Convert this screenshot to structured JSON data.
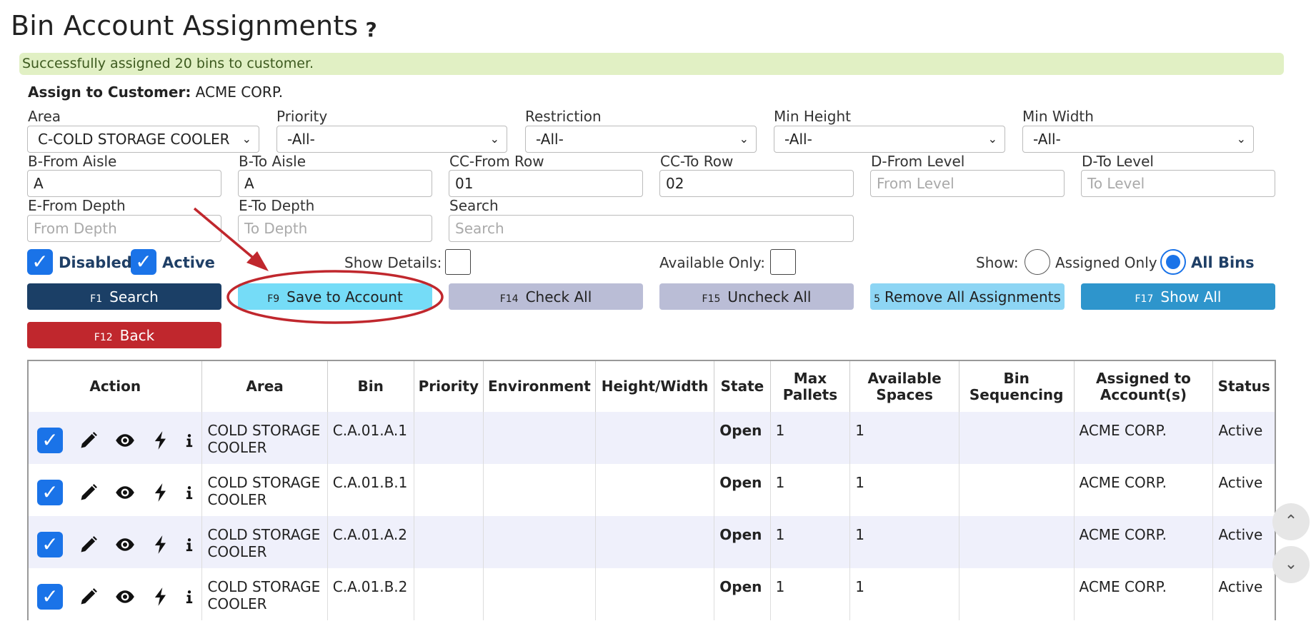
{
  "page": {
    "title": "Bin Account Assignments",
    "help_glyph": "?"
  },
  "alert": "Successfully assigned 20 bins to customer.",
  "assign": {
    "label": "Assign to Customer:",
    "value": "ACME CORP."
  },
  "filters": {
    "area": {
      "label": "Area",
      "value": "C-COLD STORAGE COOLER"
    },
    "priority": {
      "label": "Priority",
      "value": "-All-"
    },
    "restriction": {
      "label": "Restriction",
      "value": "-All-"
    },
    "min_height": {
      "label": "Min Height",
      "value": "-All-"
    },
    "min_width": {
      "label": "Min Width",
      "value": "-All-"
    },
    "from_aisle": {
      "label": "B-From Aisle",
      "value": "A",
      "placeholder": ""
    },
    "to_aisle": {
      "label": "B-To Aisle",
      "value": "A",
      "placeholder": ""
    },
    "from_row": {
      "label": "CC-From Row",
      "value": "01",
      "placeholder": ""
    },
    "to_row": {
      "label": "CC-To Row",
      "value": "02",
      "placeholder": ""
    },
    "from_level": {
      "label": "D-From Level",
      "value": "",
      "placeholder": "From Level"
    },
    "to_level": {
      "label": "D-To Level",
      "value": "",
      "placeholder": "To Level"
    },
    "from_depth": {
      "label": "E-From Depth",
      "value": "",
      "placeholder": "From Depth"
    },
    "to_depth": {
      "label": "E-To Depth",
      "value": "",
      "placeholder": "To Depth"
    },
    "search": {
      "label": "Search",
      "value": "",
      "placeholder": "Search"
    }
  },
  "options": {
    "disabled": {
      "label": "Disabled",
      "checked": true
    },
    "active": {
      "label": "Active",
      "checked": true
    },
    "show_details": {
      "label": "Show Details:",
      "checked": false
    },
    "available_only": {
      "label": "Available Only:",
      "checked": false
    },
    "show_label": "Show:",
    "assigned_only": {
      "label": "Assigned Only",
      "selected": false
    },
    "all_bins": {
      "label": "All Bins",
      "selected": true
    }
  },
  "buttons": {
    "search": {
      "key": "F1",
      "label": "Search"
    },
    "save": {
      "key": "F9",
      "label": "Save to Account"
    },
    "check_all": {
      "key": "F14",
      "label": "Check All"
    },
    "uncheck_all": {
      "key": "F15",
      "label": "Uncheck All"
    },
    "remove_all": {
      "key": "5",
      "label": "Remove All Assignments"
    },
    "show_all": {
      "key": "F17",
      "label": "Show All"
    },
    "back": {
      "key": "F12",
      "label": "Back"
    }
  },
  "table": {
    "headers": {
      "action": "Action",
      "area": "Area",
      "bin": "Bin",
      "priority": "Priority",
      "environment": "Environment",
      "height_width": "Height/Width",
      "state": "State",
      "max_pallets_1": "Max",
      "max_pallets_2": "Pallets",
      "available_spaces_1": "Available",
      "available_spaces_2": "Spaces",
      "bin_sequencing_1": "Bin",
      "bin_sequencing_2": "Sequencing",
      "assigned_1": "Assigned to",
      "assigned_2": "Account(s)",
      "status": "Status"
    },
    "rows": [
      {
        "area_1": "COLD STORAGE",
        "area_2": "COOLER",
        "bin": "C.A.01.A.1",
        "priority": "",
        "environment": "",
        "height_width": "",
        "state": "Open",
        "max_pallets": "1",
        "available_spaces": "1",
        "bin_sequencing": "",
        "assigned": "ACME CORP.",
        "status": "Active",
        "checked": true
      },
      {
        "area_1": "COLD STORAGE",
        "area_2": "COOLER",
        "bin": "C.A.01.B.1",
        "priority": "",
        "environment": "",
        "height_width": "",
        "state": "Open",
        "max_pallets": "1",
        "available_spaces": "1",
        "bin_sequencing": "",
        "assigned": "ACME CORP.",
        "status": "Active",
        "checked": true
      },
      {
        "area_1": "COLD STORAGE",
        "area_2": "COOLER",
        "bin": "C.A.01.A.2",
        "priority": "",
        "environment": "",
        "height_width": "",
        "state": "Open",
        "max_pallets": "1",
        "available_spaces": "1",
        "bin_sequencing": "",
        "assigned": "ACME CORP.",
        "status": "Active",
        "checked": true
      },
      {
        "area_1": "COLD STORAGE",
        "area_2": "COOLER",
        "bin": "C.A.01.B.2",
        "priority": "",
        "environment": "",
        "height_width": "",
        "state": "Open",
        "max_pallets": "1",
        "available_spaces": "1",
        "bin_sequencing": "",
        "assigned": "ACME CORP.",
        "status": "Active",
        "checked": true
      }
    ]
  },
  "icons": {
    "checkmark": "✓",
    "scroll_up": "⌃",
    "scroll_down": "⌄",
    "select_chevron": "⌄"
  },
  "colors": {
    "primary_blue": "#1a73e8",
    "alert_bg": "#e1f0c4",
    "search_button": "#1b3f66",
    "back_button": "#c0272d",
    "annotation_red": "#c0272d"
  }
}
